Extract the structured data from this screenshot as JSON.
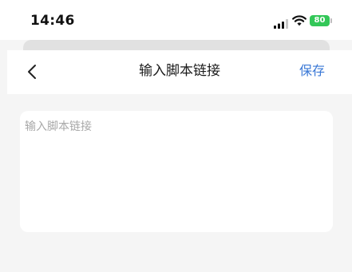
{
  "status_bar": {
    "time": "14:46",
    "battery_level": "80",
    "signal_icon": "cellular-signal-icon",
    "wifi_icon": "wifi-icon",
    "battery_icon": "battery-icon",
    "battery_color": "#33c758"
  },
  "nav": {
    "back_icon": "chevron-left-icon",
    "title": "输入脚本链接",
    "save_label": "保存",
    "accent_color": "#3a78d6"
  },
  "form": {
    "link_input": {
      "placeholder": "输入脚本链接",
      "value": ""
    }
  }
}
